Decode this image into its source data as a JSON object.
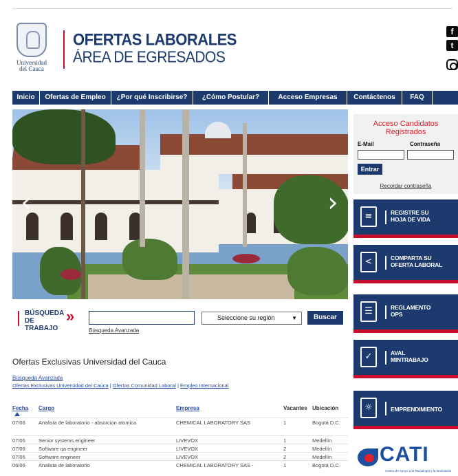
{
  "header": {
    "logo_line1": "Universidad",
    "logo_line2": "del Cauca",
    "title_line1": "OFERTAS LABORALES",
    "title_line2": "ÁREA DE EGRESADOS",
    "social": [
      {
        "icon": "facebook-icon",
        "glyph": "f"
      },
      {
        "icon": "twitter-icon",
        "glyph": "t"
      },
      {
        "icon": "instagram-icon",
        "glyph": ""
      }
    ]
  },
  "nav": {
    "items": [
      {
        "label": "Inicio"
      },
      {
        "label": "Ofertas de Empleo"
      },
      {
        "label": "¿Por qué Inscribirse?"
      },
      {
        "label": "¿Cómo Postular?"
      },
      {
        "label": "Acceso Empresas"
      },
      {
        "label": "Contáctenos"
      },
      {
        "label": "FAQ"
      }
    ]
  },
  "carousel": {
    "prev_glyph": "‹",
    "next_glyph": "›"
  },
  "login": {
    "title_line1": "Acceso Candidatos",
    "title_line2": "Registrados",
    "email_label": "E-Mail",
    "password_label": "Contraseña",
    "email_value": "",
    "password_value": "",
    "submit_label": "Entrar",
    "forgot_label": "Recordar contraseña"
  },
  "banners": [
    {
      "line1": "REGISTRE SU",
      "line2": "HOJA DE VIDA",
      "icon": "document-icon",
      "glyph": "≡"
    },
    {
      "line1": "COMPARTA SU",
      "line2": "OFERTA LABORAL",
      "icon": "share-icon",
      "glyph": "<"
    },
    {
      "line1": "REGLAMENTO",
      "line2": "OPS",
      "icon": "checklist-icon",
      "glyph": "☰"
    },
    {
      "line1": "AVAL",
      "line2": "MINTRABAJO",
      "icon": "checkmark-icon",
      "glyph": "✓"
    },
    {
      "line1": "EMPRENDIMIENTO",
      "line2": "",
      "icon": "lightbulb-icon",
      "glyph": "☼"
    }
  ],
  "cati": {
    "word": "CATI",
    "subtitle": "Centro de Apoyo a la Tecnología y la Innovación"
  },
  "search": {
    "label_line1": "BÚSQUEDA DE",
    "label_line2": "TRABAJO",
    "arrow": "»",
    "input_value": "",
    "advanced_label": "Búsqueda Avanzada",
    "region_value": "Seleccione su región",
    "region_caret": "▼",
    "button_label": "Buscar"
  },
  "offers": {
    "title": "Ofertas Exclusivas Universidad del Cauca",
    "advanced_link": "Búsqueda Avanzada",
    "links": [
      "Ofertas Exclusivas Universidad del Cauca",
      "Ofertas Comunidad Laboral",
      "Empleo Internacional"
    ],
    "separator": " | ",
    "columns": {
      "date": "Fecha",
      "role": "Cargo",
      "company": "Empresa",
      "vacancies": "Vacantes",
      "location": "Ubicación"
    },
    "rows": [
      {
        "date": "07/06",
        "role": "Analista de laboratorio - absorcion atomica",
        "company": "CHEMICAL LABORATORY SAS",
        "vacancies": "1",
        "location": "Bogotá D.C."
      },
      {
        "date": "07/06",
        "role": "Senior systems engineer",
        "company": "LIVEVOX",
        "vacancies": "1",
        "location": "Medellín"
      },
      {
        "date": "07/06",
        "role": "Software qa engineer",
        "company": "LIVEVOX",
        "vacancies": "2",
        "location": "Medellín"
      },
      {
        "date": "07/06",
        "role": "Software engineer",
        "company": "LIVEVOX",
        "vacancies": "2",
        "location": "Medellín"
      },
      {
        "date": "06/06",
        "role": "Analista de laboratorio",
        "company": "CHEMICAL LABORATORY SAS -",
        "vacancies": "1",
        "location": "Bogotá D.C."
      }
    ]
  }
}
